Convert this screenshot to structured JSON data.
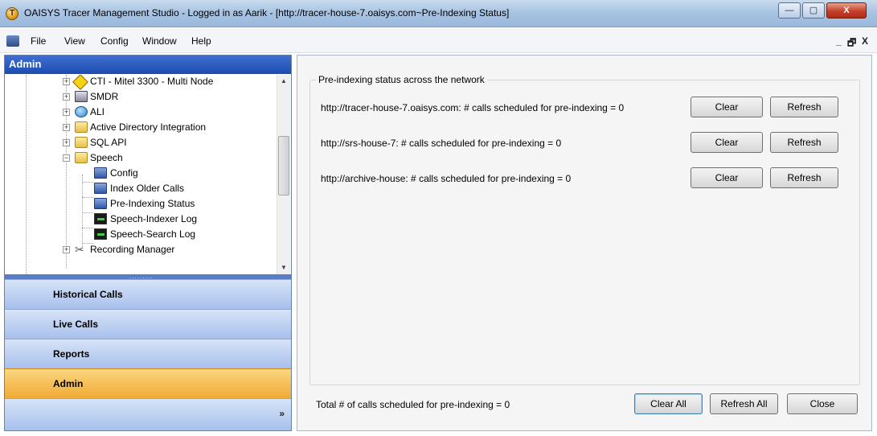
{
  "window": {
    "title": "OAISYS Tracer Management Studio - Logged in as Aarik - [http://tracer-house-7.oaisys.com~Pre-Indexing Status]",
    "app_icon_glyph": "T",
    "minimize": "—",
    "maximize": "▢",
    "close": "X"
  },
  "menu": {
    "items": [
      "File",
      "View",
      "Config",
      "Window",
      "Help"
    ],
    "mdi_minimize": "_",
    "mdi_restore": "🗗",
    "mdi_close": "X"
  },
  "admin_panel": {
    "header": "Admin",
    "tree": [
      {
        "label": "CTI - Mitel 3300 - Multi Node",
        "icon": "diamond-icon",
        "expander": "+"
      },
      {
        "label": "SMDR",
        "icon": "computer-icon",
        "expander": "+"
      },
      {
        "label": "ALI",
        "icon": "globe-icon",
        "expander": "+"
      },
      {
        "label": "Active Directory Integration",
        "icon": "folder-icon",
        "expander": "+"
      },
      {
        "label": "SQL API",
        "icon": "folder-icon",
        "expander": "+"
      },
      {
        "label": "Speech",
        "icon": "folder-open-icon",
        "expander": "−"
      },
      {
        "label": "Config",
        "icon": "document-icon"
      },
      {
        "label": "Index Older Calls",
        "icon": "document-icon"
      },
      {
        "label": "Pre-Indexing Status",
        "icon": "document-icon"
      },
      {
        "label": "Speech-Indexer Log",
        "icon": "log-icon"
      },
      {
        "label": "Speech-Search Log",
        "icon": "log-icon"
      },
      {
        "label": "Recording Manager",
        "icon": "scissors-icon",
        "expander": "+"
      }
    ],
    "nav_buttons": [
      "Historical Calls",
      "Live Calls",
      "Reports",
      "Admin"
    ],
    "active_nav": "Admin",
    "more_chevron": "»"
  },
  "status_pane": {
    "group_title": "Pre-indexing status across the network",
    "servers": [
      {
        "text": "http://tracer-house-7.oaisys.com: # calls scheduled for pre-indexing = 0",
        "clear": "Clear",
        "refresh": "Refresh"
      },
      {
        "text": "http://srs-house-7: # calls scheduled for pre-indexing = 0",
        "clear": "Clear",
        "refresh": "Refresh"
      },
      {
        "text": "http://archive-house: # calls scheduled for pre-indexing = 0",
        "clear": "Clear",
        "refresh": "Refresh"
      }
    ],
    "total": "Total # of calls scheduled for pre-indexing = 0",
    "clear_all": "Clear All",
    "refresh_all": "Refresh All",
    "close": "Close"
  }
}
